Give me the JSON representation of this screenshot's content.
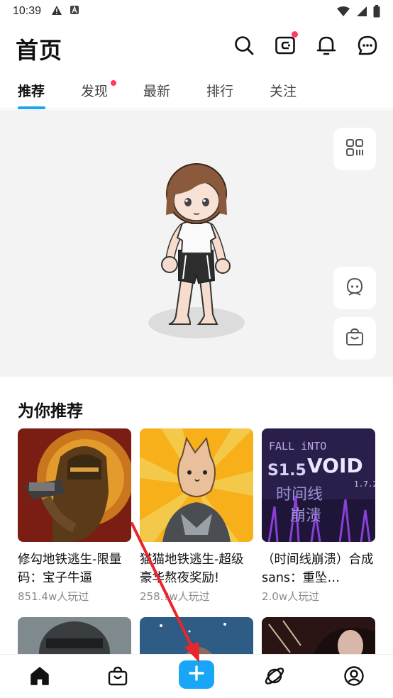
{
  "status_bar": {
    "time": "10:39"
  },
  "header": {
    "title": "首页",
    "icons": [
      "search-icon",
      "wallet-icon",
      "bell-icon",
      "chat-icon"
    ]
  },
  "tabs": [
    {
      "label": "推荐",
      "active": true
    },
    {
      "label": "发现",
      "has_dot": true
    },
    {
      "label": "最新"
    },
    {
      "label": "排行"
    },
    {
      "label": "关注"
    }
  ],
  "hero": {
    "side_buttons": [
      "qr-code-icon",
      "avatar-face-icon",
      "shopping-bag-icon"
    ]
  },
  "recommend": {
    "title": "为你推荐",
    "cards": [
      {
        "title": "修勾地铁逃生-限量码：宝子牛逼",
        "plays": "851.4w人玩过"
      },
      {
        "title": "猫猫地铁逃生-超级豪华熬夜奖励!",
        "plays": "258.?w人玩过"
      },
      {
        "title": "（时间线崩溃）合成sans：重坠…",
        "plays": "2.0w人玩过"
      }
    ],
    "card3_art": {
      "line1": "FALL iNTO",
      "line2": "VOID",
      "ver": "S1.5",
      "num": "1.7.2",
      "cn1": "时间线",
      "cn2": "崩溃"
    }
  },
  "bottom_nav": [
    "home-icon",
    "shop-bag-icon",
    "create-plus-icon",
    "planet-icon",
    "profile-icon"
  ],
  "colors": {
    "accent": "#1fa3f7",
    "dot": "#ff3b5c",
    "annotation_arrow": "#e8262b"
  }
}
